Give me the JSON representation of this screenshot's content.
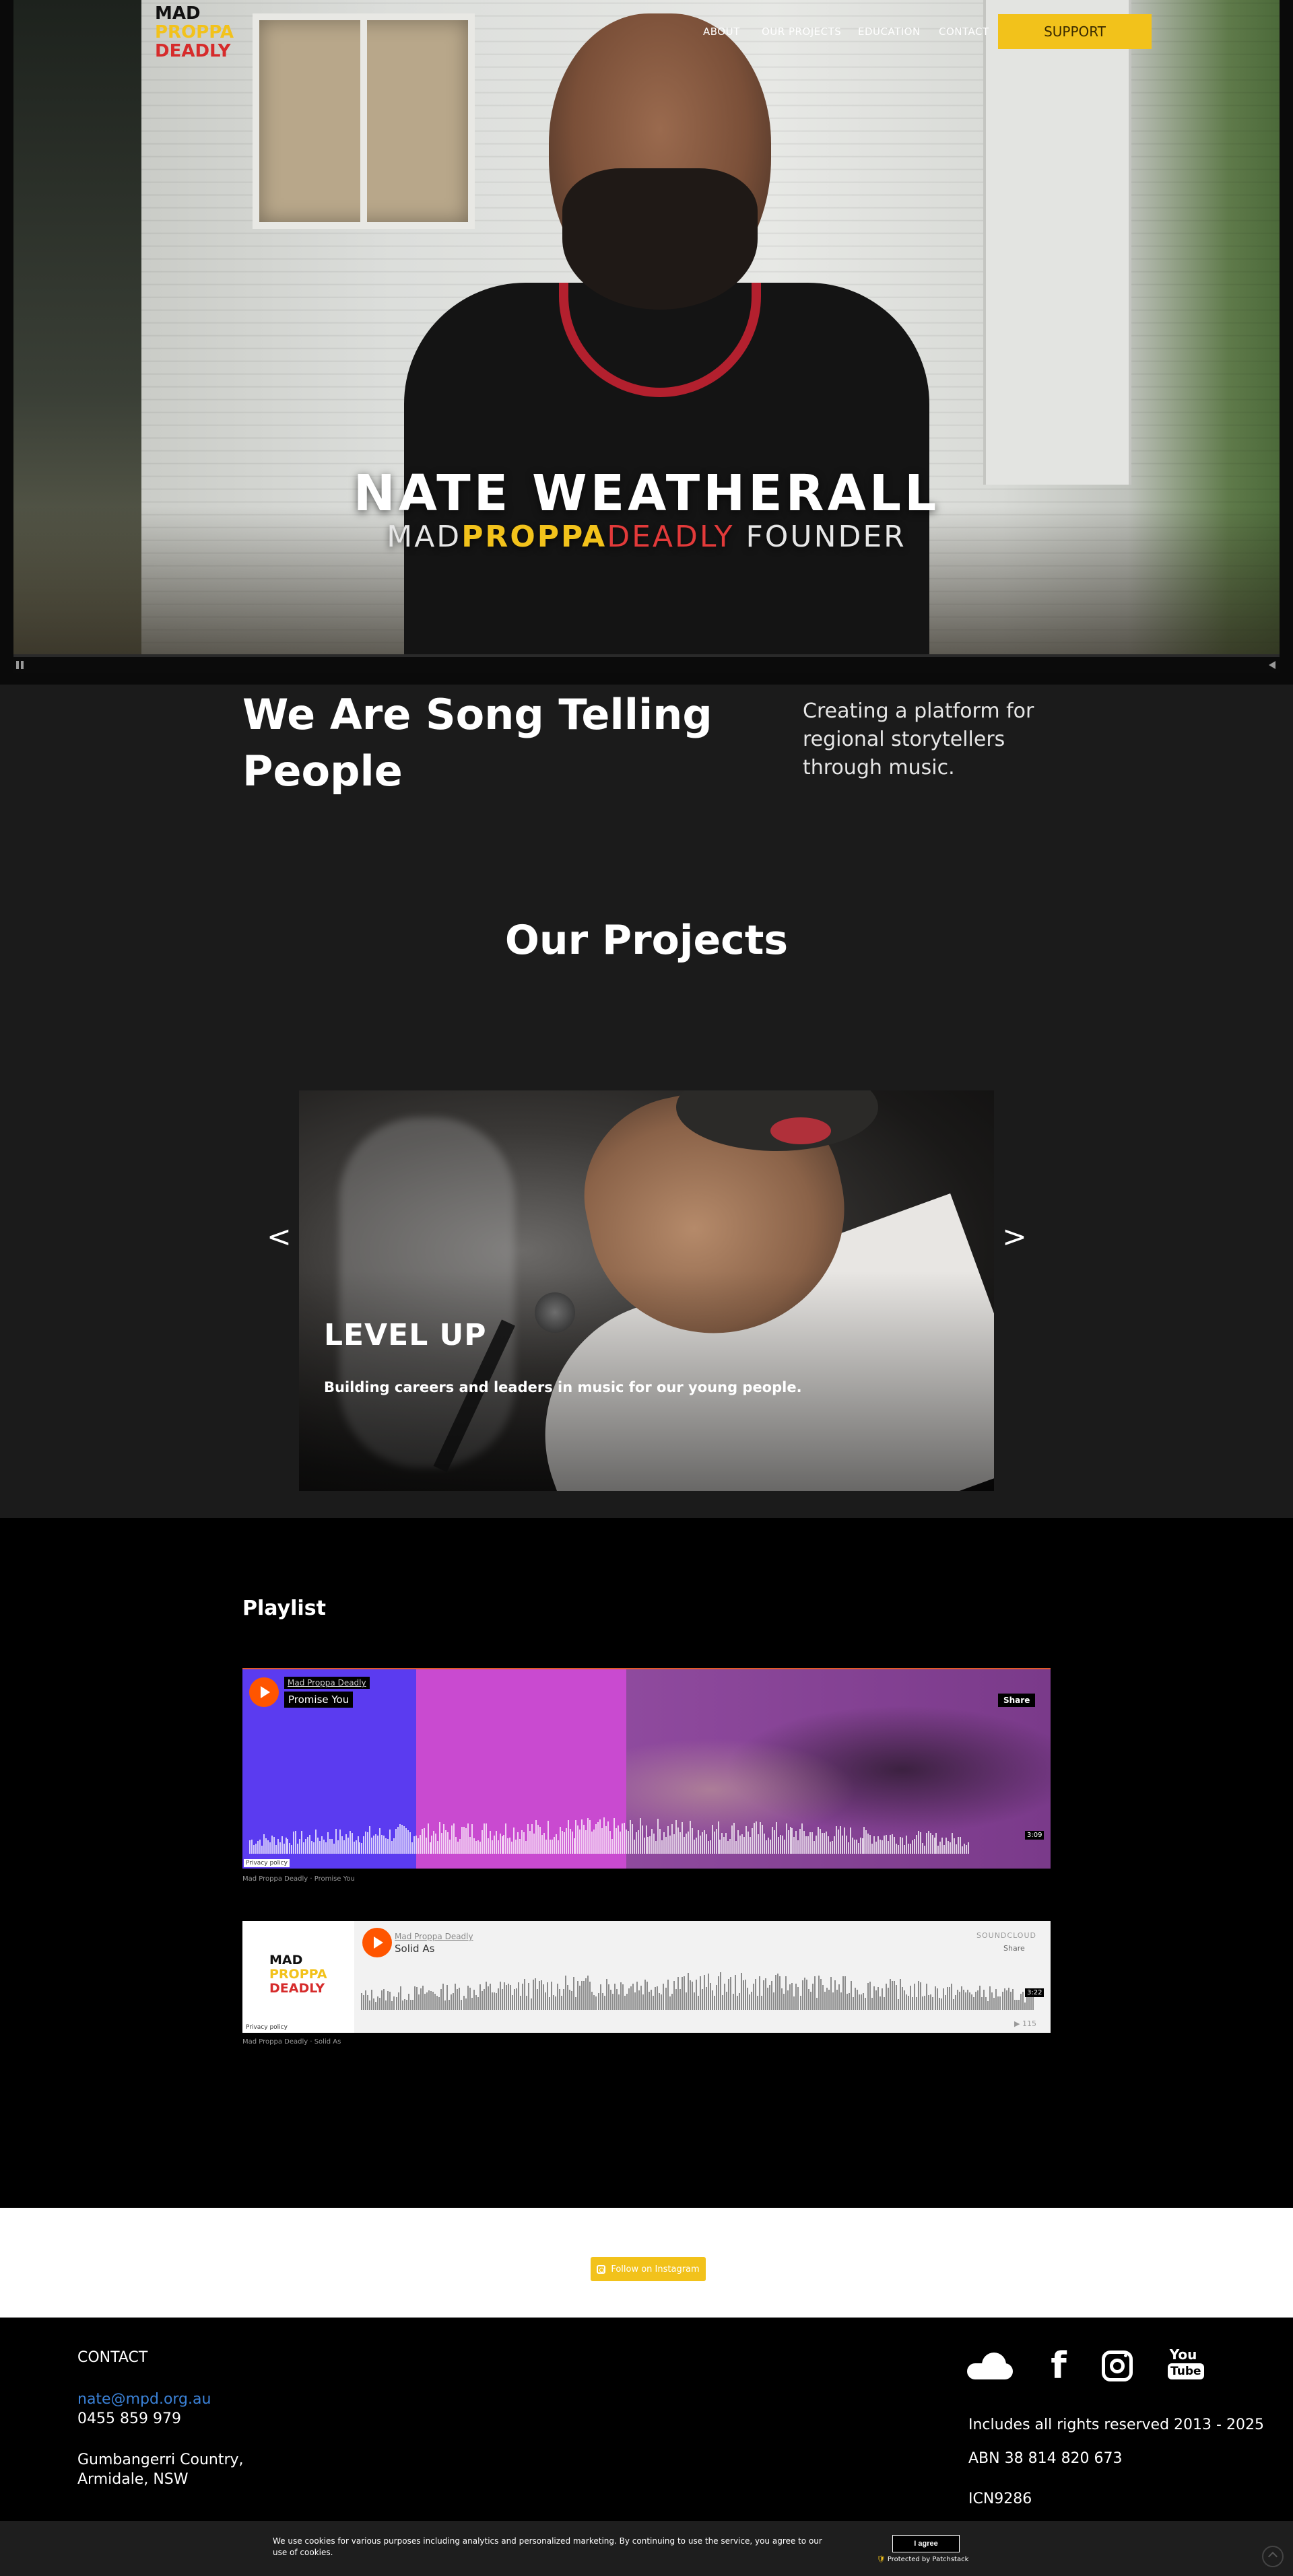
{
  "header": {
    "logo": {
      "line1": "MAD",
      "line2": "PROPPA",
      "line3": "DEADLY"
    },
    "nav": [
      {
        "label": "ABOUT"
      },
      {
        "label": "OUR PROJECTS"
      },
      {
        "label": "EDUCATION"
      },
      {
        "label": "CONTACT"
      }
    ],
    "support_label": "SUPPORT"
  },
  "hero": {
    "title": "NATE WEATHERALL",
    "subtitle_mad": "MAD",
    "subtitle_proppa": "PROPPA",
    "subtitle_deadly": "DEADLY",
    "subtitle_founder": " FOUNDER"
  },
  "about": {
    "headline": "We Are Song Telling People",
    "tagline": "Creating a platform for regional storytellers through music."
  },
  "projects": {
    "title": "Our Projects",
    "prev_arrow": "<",
    "next_arrow": ">",
    "slide": {
      "title": "LEVEL UP",
      "description": "Building careers and leaders in music for our young people."
    }
  },
  "playlist": {
    "title": "Playlist",
    "tracks": [
      {
        "artist": "Mad Proppa Deadly",
        "title": "Promise You",
        "share": "Share",
        "duration": "3:09",
        "privacy": "Privacy policy",
        "caption": "Mad Proppa Deadly · Promise You"
      },
      {
        "artist": "Mad Proppa Deadly",
        "title": "Solid As",
        "share": "Share",
        "duration": "3:22",
        "plays": "▶ 115",
        "privacy": "Privacy policy",
        "caption": "Mad Proppa Deadly · Solid As",
        "soundcloud": "SOUNDCLOUD"
      }
    ]
  },
  "instagram": {
    "label": "Follow on Instagram"
  },
  "footer": {
    "contact_heading": "CONTACT",
    "email": "nate@mpd.org.au",
    "phone": "0455 859 979",
    "address_line1": "Gumbangerri Country,",
    "address_line2": "Armidale, NSW",
    "rights": "Includes all rights reserved 2013 - 2025",
    "abn": "ABN 38 814 820 673",
    "icn": "ICN9286",
    "social_icons": [
      "soundcloud-icon",
      "facebook-icon",
      "instagram-icon",
      "youtube-icon"
    ],
    "youtube_you": "You",
    "youtube_tube": "Tube",
    "facebook_glyph": "f"
  },
  "cookie": {
    "text": "We use cookies for various purposes including analytics and personalized marketing. By continuing to use the service, you agree to our use of cookies.",
    "accept_label": "I agree",
    "protected_label": "Protected by Patchstack"
  },
  "colors": {
    "brand_yellow": "#f2c21b",
    "brand_red": "#d62b2b",
    "link_blue": "#3b82d8",
    "soundcloud_orange": "#ff5500"
  }
}
